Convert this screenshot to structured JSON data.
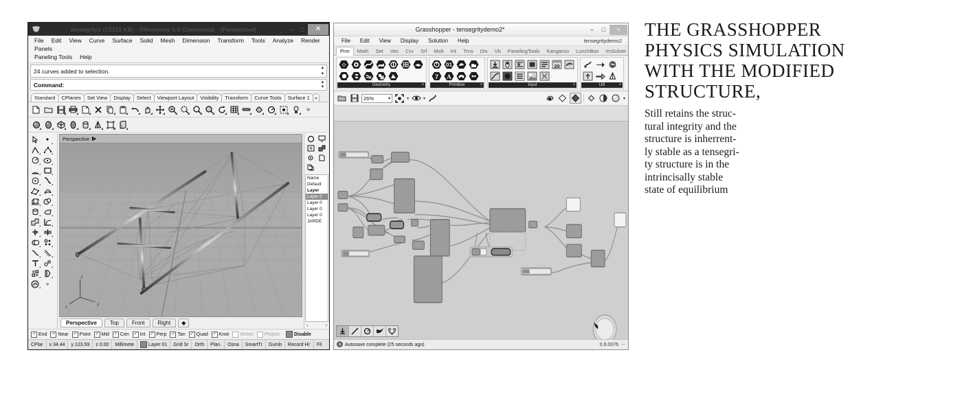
{
  "rhino": {
    "title": "tensegrity1 (13151 KB) - Rhinoceros 5.0 Commercial - [Perspective]",
    "logo_icon": "rhino-logo-icon",
    "window_buttons": [
      {
        "name": "minimize-button",
        "glyph": "–"
      },
      {
        "name": "maximize-button",
        "glyph": "□"
      },
      {
        "name": "close-button",
        "glyph": "✕"
      }
    ],
    "menus": [
      "File",
      "Edit",
      "View",
      "Curve",
      "Surface",
      "Solid",
      "Mesh",
      "Dimension",
      "Transform",
      "Tools",
      "Analyze",
      "Render",
      "Panels",
      "Paneling Tools",
      "Help"
    ],
    "command_history": "24 curves added to selection.",
    "command_prompt": "Command:",
    "toolbar_tabs": [
      "Standard",
      "CPlanes",
      "Set View",
      "Display",
      "Select",
      "Viewport Layout",
      "Visibility",
      "Transform",
      "Curve Tools",
      "Surface 1"
    ],
    "toolbar_tabs_overflow": "»",
    "viewport_label": "Perspective",
    "viewport_tabs": [
      "Perspective",
      "Top",
      "Front",
      "Right"
    ],
    "axis_labels": {
      "x": "x",
      "y": "y",
      "z": "z"
    },
    "layers_panel": {
      "header": "Name",
      "rows": [
        "Default",
        "Layer",
        "Layer 0",
        "Layer 0",
        "Layer 0",
        "Layer 0",
        "JARDE"
      ],
      "selected_index": 2,
      "nav_prev": "‹",
      "nav_next": "›"
    },
    "osnaps": [
      {
        "label": "End",
        "checked": true
      },
      {
        "label": "Near",
        "checked": true
      },
      {
        "label": "Point",
        "checked": true
      },
      {
        "label": "Mid",
        "checked": true
      },
      {
        "label": "Cen",
        "checked": true
      },
      {
        "label": "Int",
        "checked": true
      },
      {
        "label": "Perp",
        "checked": true
      },
      {
        "label": "Tan",
        "checked": true
      },
      {
        "label": "Quad",
        "checked": true
      },
      {
        "label": "Knot",
        "checked": true
      },
      {
        "label": "Vertex",
        "checked": false
      },
      {
        "label": "Project",
        "checked": false
      }
    ],
    "osnap_disable": "Disable",
    "status_items": [
      "CPlar",
      "x 34.44",
      "y 123.59",
      "z 0.00",
      "Millimetе",
      "Layer 01",
      "Grid Sr",
      "Orth",
      "Plan.",
      "Osna",
      "SmartTr",
      "Gumb",
      "Record Hi:",
      "Fil"
    ]
  },
  "grasshopper": {
    "title": "Grasshopper - tensegritydemo2*",
    "document_name": "tensegritydemo2",
    "window_buttons": [
      {
        "name": "minimize-button",
        "glyph": "–"
      },
      {
        "name": "maximize-button",
        "glyph": "□"
      },
      {
        "name": "close-button",
        "glyph": "✕"
      }
    ],
    "menus": [
      "File",
      "Edit",
      "View",
      "Display",
      "Solution",
      "Help"
    ],
    "tabs": [
      "Prm",
      "Math",
      "Set",
      "Vec",
      "Crv",
      "Srf",
      "Msh",
      "Int",
      "Trns",
      "Dis",
      "Vb",
      "PanelingTools",
      "Kangaroo",
      "LunchBox",
      "rmSolver"
    ],
    "active_tab": "Prm",
    "ribbon_groups": [
      {
        "label": "Geometry",
        "icon_count": 12
      },
      {
        "label": "Primitive",
        "icon_count": 8
      },
      {
        "label": "Input",
        "icon_count": 12
      },
      {
        "label": "Util",
        "icon_count": 6
      }
    ],
    "canvas_toolbar": {
      "open_icon": "open-file-icon",
      "save_icon": "save-icon",
      "zoom_value": "26%",
      "zoom_dropdown_glyph": "⌄",
      "fit_icon": "zoom-extents-icon",
      "preview_icon": "eye-preview-icon",
      "sketch_icon": "sketch-icon",
      "dropdown_glyph": "▾"
    },
    "status_message": "Autosave complete (25 seconds ago)",
    "status_icon": "clock-icon",
    "version": "0.9.0076",
    "bottom_tools": [
      "download-icon",
      "line-icon",
      "circle-icon",
      "bird-icon",
      "widget-icon"
    ]
  },
  "text_panel": {
    "heading_lines": [
      "THE GRASSHOPPER",
      "PHYSICS SIMULATION",
      "WITH THE MODIFIED",
      "STRUCTURE,"
    ],
    "body_lines": [
      "Still retains the struc-",
      "tural integrity and the",
      "structure is inherrent-",
      "ly stable as a tensegri-",
      "ty structure is in the",
      "intrincisally stable",
      "state of equilibrium"
    ]
  },
  "colors": {
    "page_background": "#ffffff",
    "rhino_titlebar": "#2b2b2b",
    "rhino_chrome": "#f0f0f0",
    "rhino_viewport": "#a8a8a8",
    "gh_canvas": "#cfcfcf",
    "gh_group_label": "#262626",
    "text_ink": "#1a1a1a"
  }
}
